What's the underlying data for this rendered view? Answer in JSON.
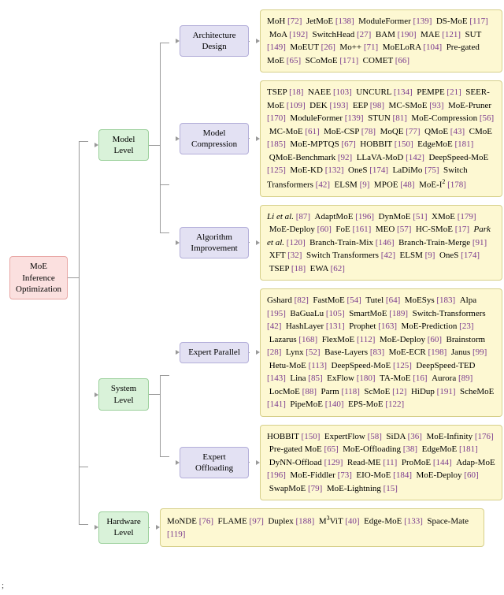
{
  "root": "MoE Inference Optimization",
  "levels": {
    "model": "Model Level",
    "system": "System Level",
    "hardware": "Hardware Level"
  },
  "subs": {
    "arch": "Architecture Design",
    "comp": "Model Compression",
    "algo": "Algorithm Improvement",
    "ep": "Expert Parallel",
    "eo": "Expert Offloading"
  },
  "leaves": {
    "arch": [
      [
        "MoH",
        "72"
      ],
      [
        "JetMoE",
        "138"
      ],
      [
        "ModuleFormer",
        "139"
      ],
      [
        "DS-MoE",
        "117"
      ],
      [
        "MoA",
        "192"
      ],
      [
        "SwitchHead",
        "27"
      ],
      [
        "BAM",
        "190"
      ],
      [
        "MAE",
        "121"
      ],
      [
        "SUT",
        "149"
      ],
      [
        "MoEUT",
        "26"
      ],
      [
        "Mo++",
        "71"
      ],
      [
        "MoELoRA",
        "104"
      ],
      [
        "Pre-gated MoE",
        "65"
      ],
      [
        "SCoMoE",
        "171"
      ],
      [
        "COMET",
        "66"
      ]
    ],
    "comp": [
      [
        "TSEP",
        "18"
      ],
      [
        "NAEE",
        "103"
      ],
      [
        "UNCURL",
        "134"
      ],
      [
        "PEMPE",
        "21"
      ],
      [
        "SEER-MoE",
        "109"
      ],
      [
        "DEK",
        "193"
      ],
      [
        "EEP",
        "98"
      ],
      [
        "MC-SMoE",
        "93"
      ],
      [
        "MoE-Pruner",
        "170"
      ],
      [
        "ModuleFormer",
        "139"
      ],
      [
        "STUN",
        "81"
      ],
      [
        "MoE-Compression",
        "56"
      ],
      [
        "MC-MoE",
        "61"
      ],
      [
        "MoE-CSP",
        "78"
      ],
      [
        "MoQE",
        "77"
      ],
      [
        "QMoE",
        "43"
      ],
      [
        "CMoE",
        "185"
      ],
      [
        "MoE-MPTQS",
        "67"
      ],
      [
        "HOBBIT",
        "150"
      ],
      [
        "EdgeMoE",
        "181"
      ],
      [
        "QMoE-Benchmark",
        "92"
      ],
      [
        "LLaVA-MoD",
        "142"
      ],
      [
        "DeepSpeed-MoE",
        "125"
      ],
      [
        "MoE-KD",
        "132"
      ],
      [
        "OneS",
        "174"
      ],
      [
        "LaDiMo",
        "75"
      ],
      [
        "Switch Transformers",
        "42"
      ],
      [
        "ELSM",
        "9"
      ],
      [
        "MPOE",
        "48"
      ],
      [
        "MoE-I²",
        "178"
      ]
    ],
    "algo": [
      [
        "Li et al.",
        "87",
        "ital"
      ],
      [
        "AdaptMoE",
        "196"
      ],
      [
        "DynMoE",
        "51"
      ],
      [
        "XMoE",
        "179"
      ],
      [
        "MoE-Deploy",
        "60"
      ],
      [
        "FoE",
        "161"
      ],
      [
        "MEO",
        "57"
      ],
      [
        "HC-SMoE",
        "17"
      ],
      [
        "Park et al.",
        "120",
        "ital"
      ],
      [
        "Branch-Train-Mix",
        "146"
      ],
      [
        "Branch-Train-Merge",
        "91"
      ],
      [
        "XFT",
        "32"
      ],
      [
        "Switch Transformers",
        "42"
      ],
      [
        "ELSM",
        "9"
      ],
      [
        "OneS",
        "174"
      ],
      [
        "TSEP",
        "18"
      ],
      [
        "EWA",
        "62"
      ]
    ],
    "ep": [
      [
        "Gshard",
        "82"
      ],
      [
        "FastMoE",
        "54"
      ],
      [
        "Tutel",
        "64"
      ],
      [
        "MoESys",
        "183"
      ],
      [
        "Alpa",
        "195"
      ],
      [
        "BaGuaLu",
        "105"
      ],
      [
        "SmartMoE",
        "189"
      ],
      [
        "Switch-Transformers",
        "42"
      ],
      [
        "HashLayer",
        "131"
      ],
      [
        "Prophet",
        "163"
      ],
      [
        "MoE-Prediction",
        "23"
      ],
      [
        "Lazarus",
        "168"
      ],
      [
        "FlexMoE",
        "112"
      ],
      [
        "MoE-Deploy",
        "60"
      ],
      [
        "Brainstorm",
        "28"
      ],
      [
        "Lynx",
        "52"
      ],
      [
        "Base-Layers",
        "83"
      ],
      [
        "MoE-ECR",
        "198"
      ],
      [
        "Janus",
        "99"
      ],
      [
        "Hetu-MoE",
        "113"
      ],
      [
        "DeepSpeed-MoE",
        "125"
      ],
      [
        "DeepSpeed-TED",
        "143"
      ],
      [
        "Lina",
        "85"
      ],
      [
        "ExFlow",
        "180"
      ],
      [
        "TA-MoE",
        "16"
      ],
      [
        "Aurora",
        "89"
      ],
      [
        "LocMoE",
        "88"
      ],
      [
        "Parm",
        "118"
      ],
      [
        "ScMoE",
        "12"
      ],
      [
        "HiDup",
        "191"
      ],
      [
        "ScheMoE",
        "141"
      ],
      [
        "PipeMoE",
        "140"
      ],
      [
        "EPS-MoE",
        "122"
      ]
    ],
    "eo": [
      [
        "HOBBIT",
        "150"
      ],
      [
        "ExpertFlow",
        "58"
      ],
      [
        "SiDA",
        "36"
      ],
      [
        "MoE-Infinity",
        "176"
      ],
      [
        "Pre-gated MoE",
        "65"
      ],
      [
        "MoE-Offloading",
        "38"
      ],
      [
        "EdgeMoE",
        "181"
      ],
      [
        "DyNN-Offload",
        "129"
      ],
      [
        "Read-ME",
        "11"
      ],
      [
        "ProMoE",
        "144"
      ],
      [
        "Adap-MoE",
        "196"
      ],
      [
        "MoE-Fiddler",
        "73"
      ],
      [
        "EIO-MoE",
        "184"
      ],
      [
        "MoE-Deploy",
        "60"
      ],
      [
        "SwapMoE",
        "79"
      ],
      [
        "MoE-Lightning",
        "15"
      ]
    ],
    "hw": [
      [
        "MoNDE",
        "76"
      ],
      [
        "FLAME",
        "97"
      ],
      [
        "Duplex",
        "188"
      ],
      [
        "M³ViT",
        "40"
      ],
      [
        "Edge-MoE",
        "133"
      ],
      [
        "Space-Mate",
        "119"
      ]
    ]
  },
  "chart_data": {
    "type": "tree",
    "root": "MoE Inference Optimization",
    "children": [
      {
        "name": "Model Level",
        "children": [
          {
            "name": "Architecture Design",
            "items": "leaves.arch"
          },
          {
            "name": "Model Compression",
            "items": "leaves.comp"
          },
          {
            "name": "Algorithm Improvement",
            "items": "leaves.algo"
          }
        ]
      },
      {
        "name": "System Level",
        "children": [
          {
            "name": "Expert Parallel",
            "items": "leaves.ep"
          },
          {
            "name": "Expert Offloading",
            "items": "leaves.eo"
          }
        ]
      },
      {
        "name": "Hardware Level",
        "items": "leaves.hw"
      }
    ]
  }
}
